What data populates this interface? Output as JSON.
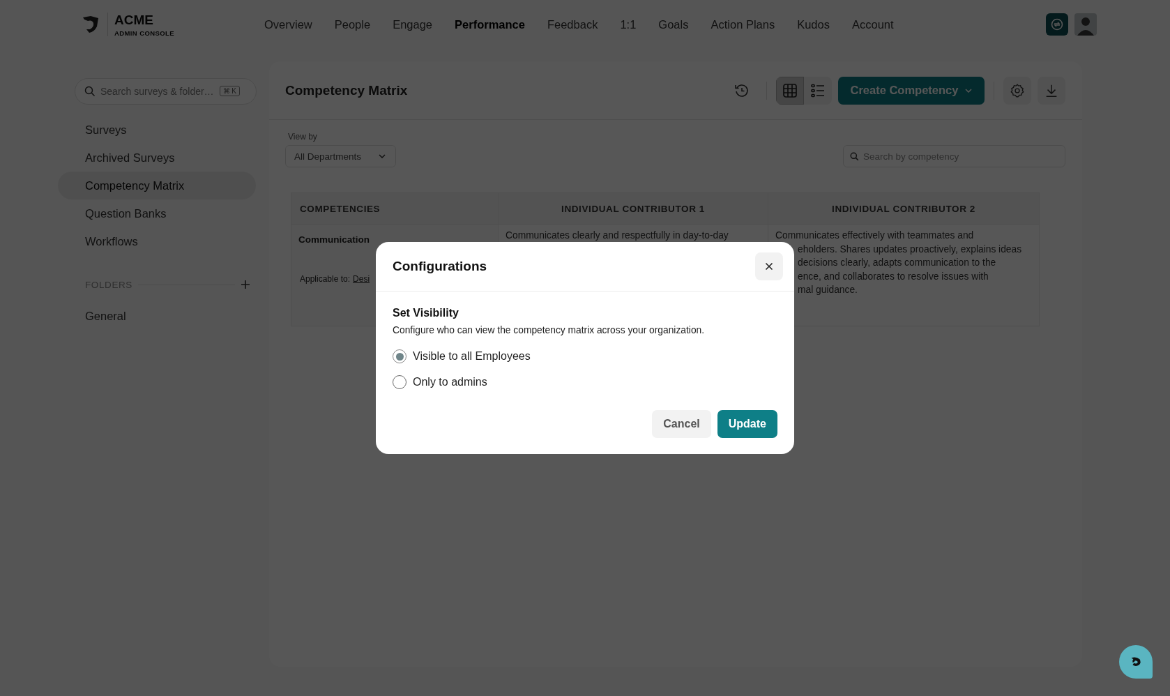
{
  "header": {
    "logo": {
      "name": "ACME",
      "subtitle": "ADMIN CONSOLE"
    },
    "nav": [
      {
        "label": "Overview",
        "selected": false
      },
      {
        "label": "People",
        "selected": false
      },
      {
        "label": "Engage",
        "selected": false
      },
      {
        "label": "Performance",
        "selected": true
      },
      {
        "label": "Feedback",
        "selected": false
      },
      {
        "label": "1:1",
        "selected": false
      },
      {
        "label": "Goals",
        "selected": false
      },
      {
        "label": "Action Plans",
        "selected": false
      },
      {
        "label": "Kudos",
        "selected": false
      },
      {
        "label": "Account",
        "selected": false
      }
    ]
  },
  "sidebar": {
    "search": {
      "placeholder": "Search surveys & folder…",
      "shortcut": "⌘ K"
    },
    "items": [
      {
        "label": "Surveys",
        "selected": false
      },
      {
        "label": "Archived Surveys",
        "selected": false
      },
      {
        "label": "Competency Matrix",
        "selected": true
      },
      {
        "label": "Question Banks",
        "selected": false
      },
      {
        "label": "Workflows",
        "selected": false
      }
    ],
    "folders": {
      "title": "FOLDERS",
      "items": [
        {
          "label": "General"
        }
      ]
    }
  },
  "main": {
    "title": "Competency Matrix",
    "views": [
      {
        "kind": "grid",
        "selected": true
      },
      {
        "kind": "list",
        "selected": false
      }
    ],
    "create_button": "Create Competency",
    "view_by": {
      "label": "View by",
      "value": "All Departments"
    },
    "search": {
      "placeholder": "Search by competency"
    },
    "table": {
      "columns": [
        "COMPETENCIES",
        "INDIVIDUAL CONTRIBUTOR 1",
        "INDIVIDUAL CONTRIBUTOR 2"
      ],
      "rows": [
        {
          "cells": [
            {
              "kind": "competency",
              "name": "Communication",
              "applicable_label": "Applicable to:",
              "applicable_link": "Desi"
            },
            {
              "kind": "description",
              "lines": [
                "Communicates clearly and respectfully in day-to-day"
              ]
            },
            {
              "kind": "description",
              "lines": [
                "Communicates effectively with teammates and",
                "eholders. Shares updates proactively, explains ideas",
                "decisions clearly, adapts communication to the",
                "ence, and collaborates to resolve issues with",
                "mal guidance."
              ]
            }
          ]
        }
      ]
    }
  },
  "dialog": {
    "title": "Configurations",
    "section_title": "Set Visibility",
    "description": "Configure who can view the competency matrix across your organization.",
    "options": [
      {
        "label": "Visible to all Employees",
        "selected": true
      },
      {
        "label": "Only to admins",
        "selected": false
      }
    ],
    "buttons": [
      {
        "label": "Cancel",
        "kind": "secondary"
      },
      {
        "label": "Update",
        "kind": "primary"
      }
    ]
  }
}
